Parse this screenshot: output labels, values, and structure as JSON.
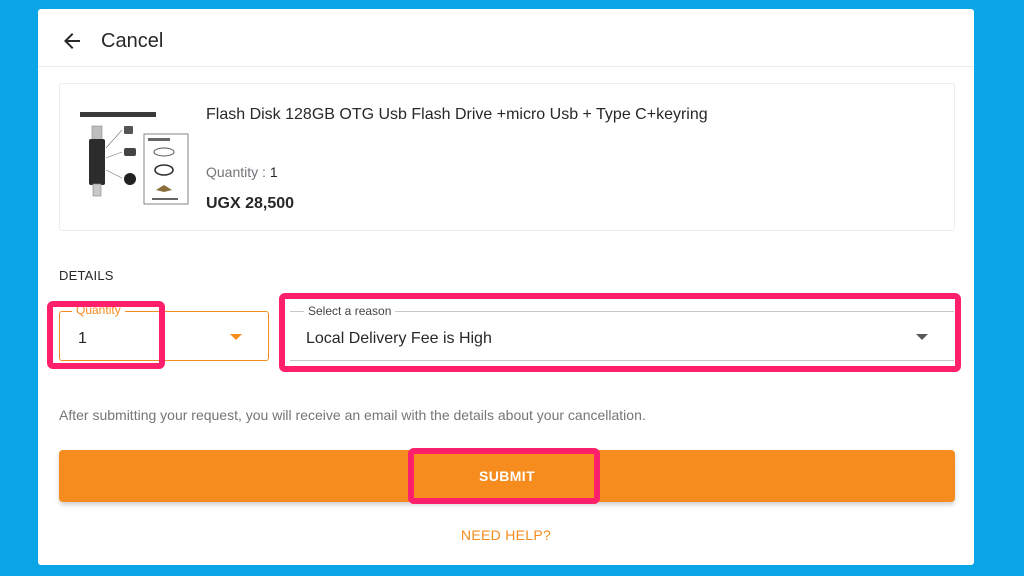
{
  "header": {
    "back_icon": "arrow-left-icon",
    "title": "Cancel"
  },
  "product": {
    "image_label": "3 in 1 OTG USB flash drive",
    "name": "Flash Disk 128GB OTG Usb Flash Drive +micro Usb + Type C+keyring",
    "quantity_label": "Quantity : ",
    "quantity_value": "1",
    "price": "UGX 28,500"
  },
  "details": {
    "section_label": "DETAILS",
    "quantity_field": {
      "legend": "Quantity",
      "value": "1"
    },
    "reason_field": {
      "legend": "Select a reason",
      "value": "Local Delivery Fee is High"
    }
  },
  "note": "After submitting your request, you will receive an email with the details about your cancellation.",
  "submit_label": "SUBMIT",
  "help_label": "NEED HELP?",
  "colors": {
    "accent": "#f68b1e",
    "background": "#0aa5e6",
    "highlight": "#ff1f6b"
  }
}
